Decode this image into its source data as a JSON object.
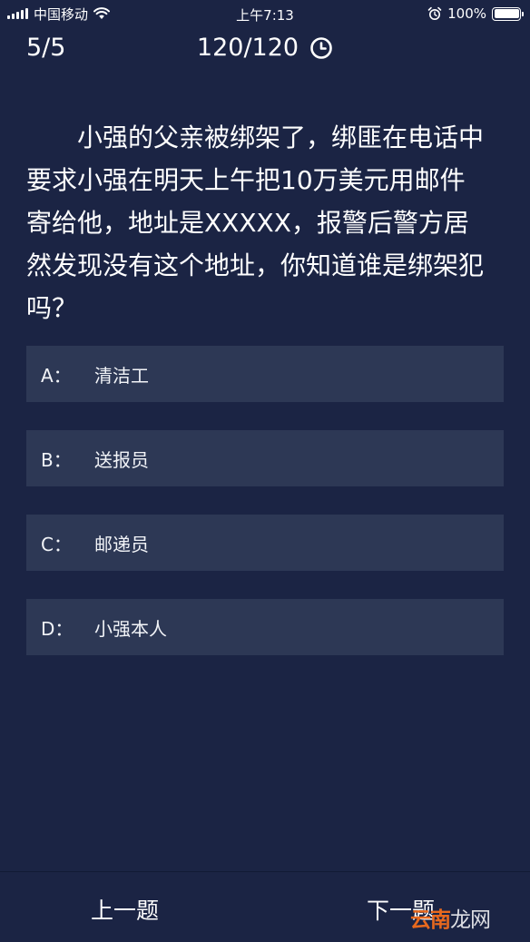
{
  "status_bar": {
    "carrier": "中国移动",
    "time": "上午7:13",
    "battery": "100%"
  },
  "header": {
    "progress": "5/5",
    "timer": "120/120"
  },
  "question": {
    "text": "小强的父亲被绑架了，绑匪在电话中要求小强在明天上午把10万美元用邮件寄给他，地址是XXXXX，报警后警方居然发现没有这个地址，你知道谁是绑架犯吗？"
  },
  "options": [
    {
      "key": "A：",
      "label": "清洁工"
    },
    {
      "key": "B：",
      "label": "送报员"
    },
    {
      "key": "C：",
      "label": "邮递员"
    },
    {
      "key": "D：",
      "label": "小强本人"
    }
  ],
  "navigation": {
    "prev_label": "上一题",
    "next_label": "下一题"
  },
  "watermark": {
    "brand": "云南",
    "rest": "龙网"
  },
  "colors": {
    "background": "#1b2444",
    "option_background": "#2d3855",
    "watermark": "#e8691e"
  }
}
